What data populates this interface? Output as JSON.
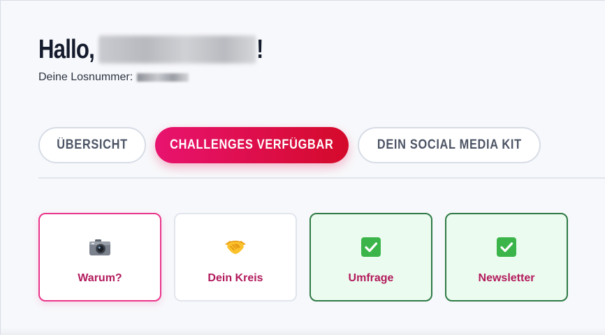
{
  "header": {
    "greeting_prefix": "Hallo,",
    "greeting_suffix": "!",
    "ticket_label": "Deine Losnummer:"
  },
  "tabs": [
    {
      "label": "ÜBERSICHT",
      "active": false
    },
    {
      "label": "CHALLENGES VERFÜGBAR",
      "active": true
    },
    {
      "label": "DEIN SOCIAL MEDIA KIT",
      "active": false
    }
  ],
  "cards": [
    {
      "label": "Warum?",
      "icon": "camera-icon",
      "state": "active"
    },
    {
      "label": "Dein Kreis",
      "icon": "handshake-icon",
      "state": "default"
    },
    {
      "label": "Umfrage",
      "icon": "check-icon",
      "state": "done"
    },
    {
      "label": "Newsletter",
      "icon": "check-icon",
      "state": "done"
    }
  ],
  "colors": {
    "primary": "#e8136f",
    "primary_end": "#d40a2a",
    "done_border": "#2e7a45",
    "done_bg": "#ecfbef",
    "card_label": "#b21a5c",
    "check_green": "#3bb54a"
  }
}
